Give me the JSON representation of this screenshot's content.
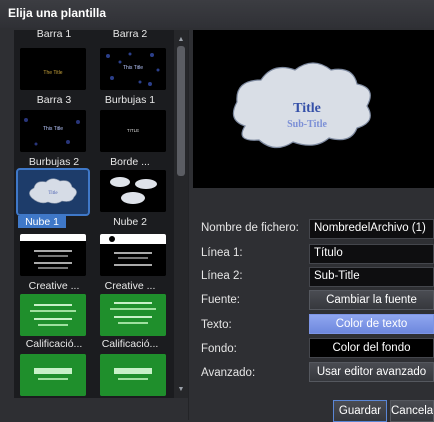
{
  "window": {
    "title": "Elija una plantilla"
  },
  "gallery": {
    "items": [
      {
        "label": "Barra 1"
      },
      {
        "label": "Barra 2"
      },
      {
        "label": "Barra 3"
      },
      {
        "label": "Burbujas 1"
      },
      {
        "label": "Burbujas 2"
      },
      {
        "label": "Borde ..."
      },
      {
        "label": "Nube 1",
        "selected": true
      },
      {
        "label": "Nube 2"
      },
      {
        "label": "Creative ..."
      },
      {
        "label": "Creative ..."
      },
      {
        "label": "Calificació..."
      },
      {
        "label": "Calificació..."
      }
    ]
  },
  "preview": {
    "title": "Title",
    "subtitle": "Sub-Title"
  },
  "form": {
    "filename_label": "Nombre de fichero:",
    "filename_value": "NombredelArchivo (1)",
    "line1_label": "Línea 1:",
    "line1_value": "Título",
    "line2_label": "Línea 2:",
    "line2_value": "Sub-Title",
    "font_label": "Fuente:",
    "font_button": "Cambiar la fuente",
    "text_label": "Texto:",
    "text_button": "Color de texto",
    "bg_label": "Fondo:",
    "bg_button": "Color del fondo",
    "advanced_label": "Avanzado:",
    "advanced_button": "Usar editor avanzado"
  },
  "footer": {
    "save": "Guardar",
    "cancel": "Cancelar"
  },
  "colors": {
    "accent": "#3f78c8",
    "text_color_button": "#7d95e6"
  }
}
